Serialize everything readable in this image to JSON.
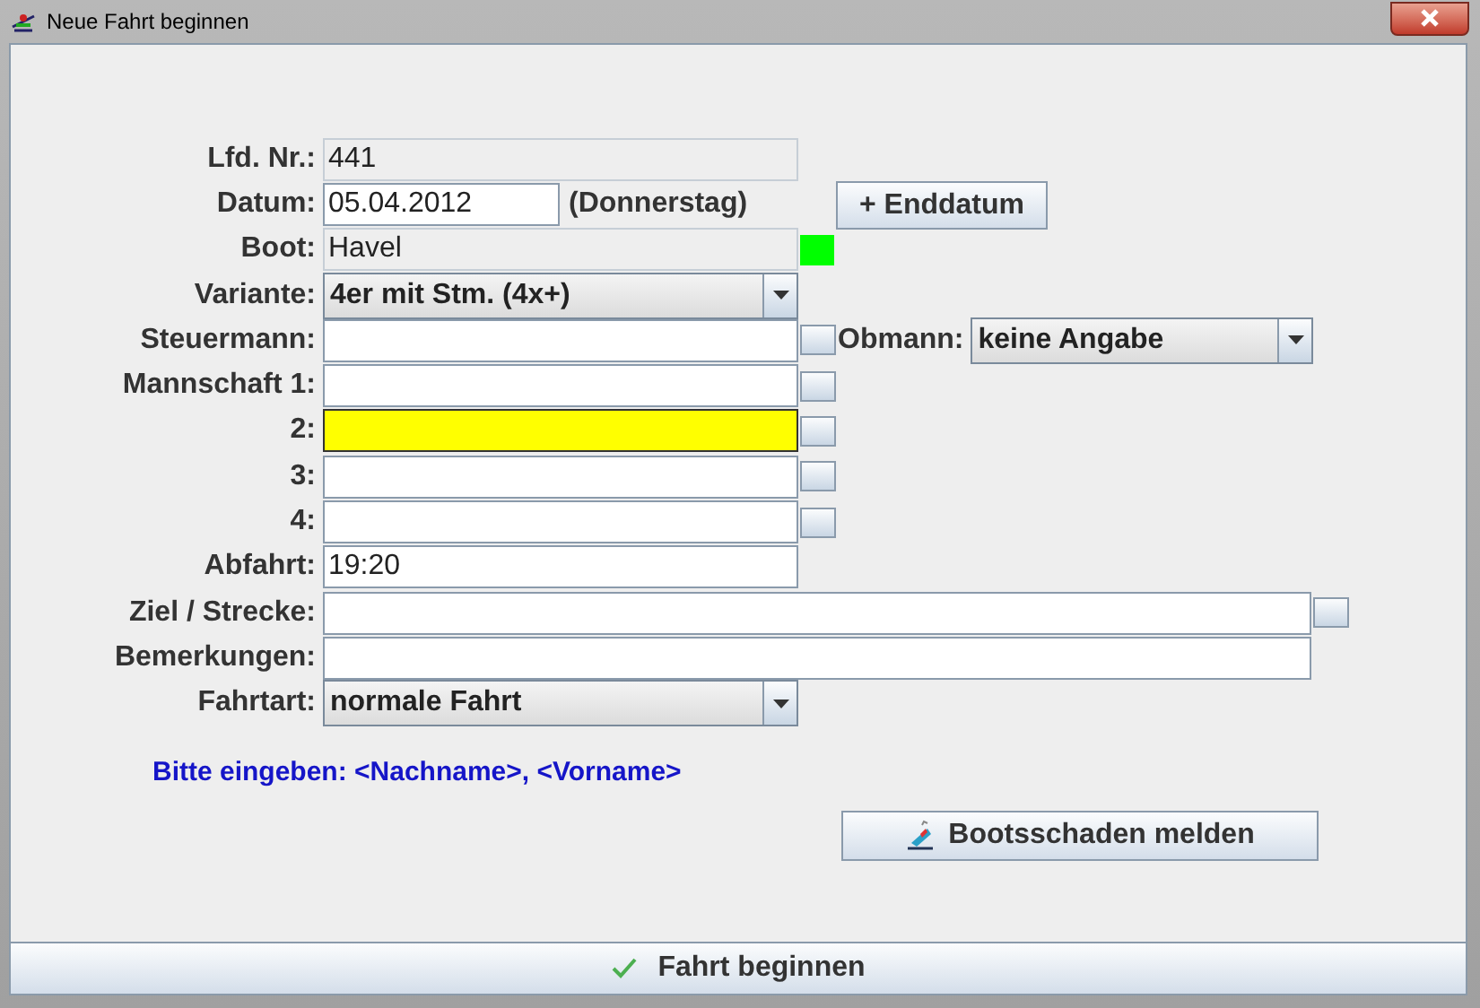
{
  "window": {
    "title": "Neue Fahrt beginnen"
  },
  "rows": [
    {
      "kind": "readonly",
      "label": "Lfd. Nr.:",
      "value": "441"
    },
    {
      "kind": "date",
      "label": "Datum:",
      "value": "05.04.2012",
      "weekday": "(Donnerstag)",
      "button": "+ Enddatum"
    },
    {
      "kind": "boat",
      "label": "Boot:",
      "value": "Havel",
      "color": "#00ff00"
    },
    {
      "kind": "combo",
      "label": "Variante:",
      "value": "4er mit Stm. (4x+)"
    },
    {
      "kind": "person",
      "label": "Steuermann:",
      "focused": false,
      "side_label": "Obmann:",
      "side_value": "keine Angabe"
    },
    {
      "kind": "person",
      "label": "Mannschaft 1:",
      "focused": false
    },
    {
      "kind": "person",
      "label": "2:",
      "focused": true
    },
    {
      "kind": "person",
      "label": "3:",
      "focused": false
    },
    {
      "kind": "person",
      "label": "4:",
      "focused": false
    },
    {
      "kind": "text",
      "label": "Abfahrt:",
      "value": "19:20"
    },
    {
      "kind": "wide",
      "label": "Ziel / Strecke:",
      "picker": true
    },
    {
      "kind": "wide",
      "label": "Bemerkungen:",
      "picker": false
    },
    {
      "kind": "combo",
      "label": "Fahrtart:",
      "value": "normale Fahrt"
    }
  ],
  "hint": "Bitte eingeben: <Nachname>,  <Vorname>",
  "damage_button": "Bootsschaden melden",
  "start_button": "Fahrt beginnen"
}
